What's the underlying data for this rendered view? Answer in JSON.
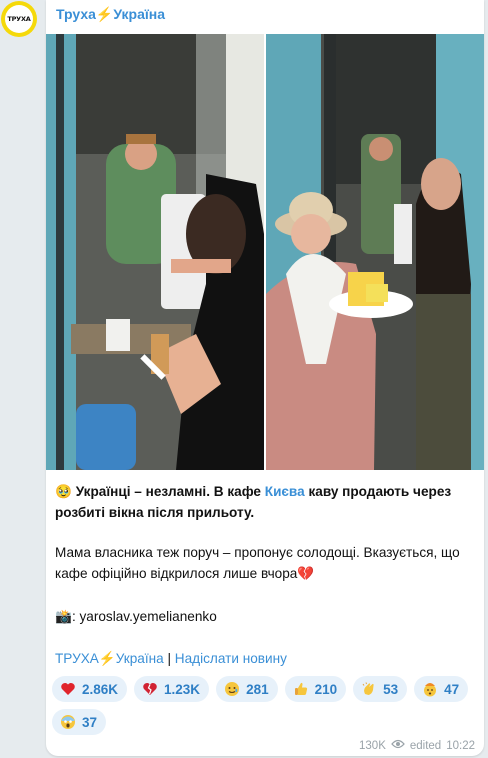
{
  "channel": {
    "avatar_text": "ТРУХА",
    "name": "Труха⚡Україна"
  },
  "photos": {
    "left_name": "photo-cafe-owner",
    "right_name": "photo-mother-with-dessert"
  },
  "post": {
    "p1_emoji": "🥹",
    "p1_bold_before": "Українці – незламні. В кафе",
    "p1_link": "Києва",
    "p1_bold_after": "каву продають через розбиті вікна після прильоту.",
    "p2_text": "Мама власника теж поруч – пропонує солодощі. Вказується, що кафе офіційно відкрилося лише вчора",
    "p2_emoji": "💔",
    "p3_emoji": "📸",
    "p3_text": ": yaroslav.yemelianenko",
    "footer_link1": "ТРУХА⚡Україна",
    "footer_sep": " | ",
    "footer_link2": "Надіслати новину"
  },
  "reactions": [
    {
      "icon": "heart",
      "count": "2.86K"
    },
    {
      "icon": "broken-heart",
      "count": "1.23K"
    },
    {
      "icon": "tear-smile",
      "count": "281"
    },
    {
      "icon": "thumbs-up",
      "count": "210"
    },
    {
      "icon": "clap",
      "count": "53"
    },
    {
      "icon": "mind-blown",
      "count": "47"
    },
    {
      "icon": "scream",
      "count": "37"
    }
  ],
  "meta": {
    "views": "130K",
    "edited": "edited",
    "time": "10:22"
  },
  "colors": {
    "accent": "#3a8fd6",
    "reaction_bg": "#e7f1fa",
    "background": "#e6ebee"
  }
}
